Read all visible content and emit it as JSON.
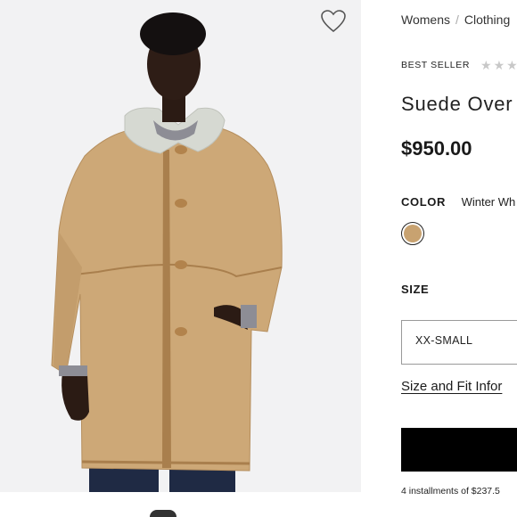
{
  "breadcrumb": {
    "items": [
      "Womens",
      "Clothing"
    ],
    "separator": "/"
  },
  "badge": {
    "label": "BEST SELLER",
    "rating_stars": 5,
    "rating_filled": 0
  },
  "product": {
    "title": "Suede Over",
    "price": "$950.00"
  },
  "color": {
    "label": "COLOR",
    "value": "Winter Wh",
    "swatch_hex": "#c8a270"
  },
  "size": {
    "label": "SIZE",
    "selected": "XX-SMALL"
  },
  "links": {
    "size_fit": "Size and Fit Infor"
  },
  "installments": {
    "text": "4 installments of $237.5"
  },
  "icons": {
    "favorite": "heart-outline-icon"
  }
}
